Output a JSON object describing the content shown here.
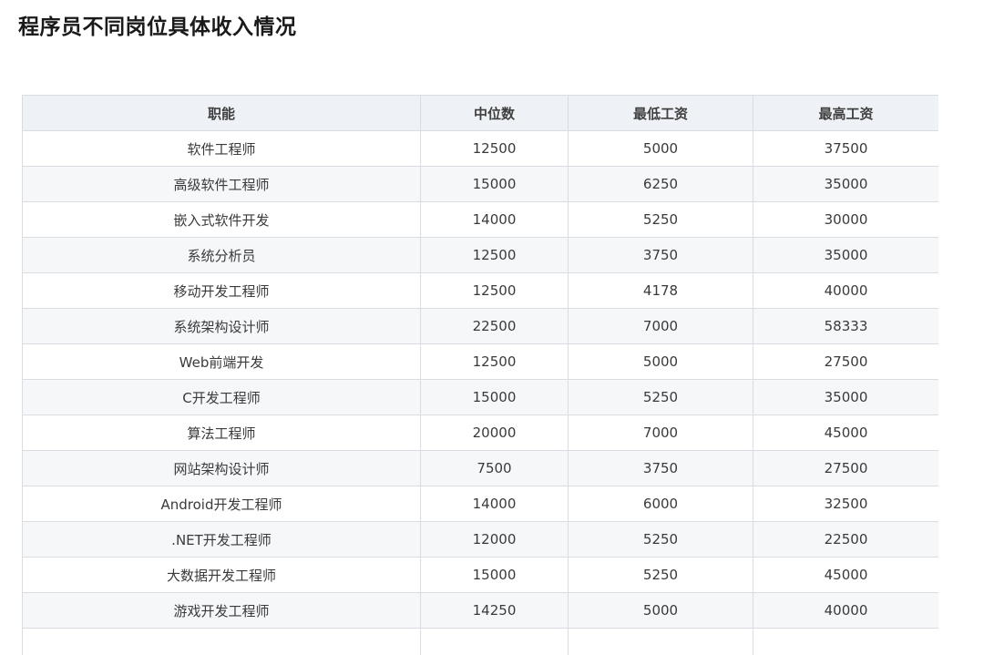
{
  "title": "程序员不同岗位具体收入情况",
  "table": {
    "headers": [
      "职能",
      "中位数",
      "最低工资",
      "最高工资"
    ],
    "rows": [
      [
        "软件工程师",
        "12500",
        "5000",
        "37500"
      ],
      [
        "高级软件工程师",
        "15000",
        "6250",
        "35000"
      ],
      [
        "嵌入式软件开发",
        "14000",
        "5250",
        "30000"
      ],
      [
        "系统分析员",
        "12500",
        "3750",
        "35000"
      ],
      [
        "移动开发工程师",
        "12500",
        "4178",
        "40000"
      ],
      [
        "系统架构设计师",
        "22500",
        "7000",
        "58333"
      ],
      [
        "Web前端开发",
        "12500",
        "5000",
        "27500"
      ],
      [
        "C开发工程师",
        "15000",
        "5250",
        "35000"
      ],
      [
        "算法工程师",
        "20000",
        "7000",
        "45000"
      ],
      [
        "网站架构设计师",
        "7500",
        "3750",
        "27500"
      ],
      [
        "Android开发工程师",
        "14000",
        "6000",
        "32500"
      ],
      [
        ".NET开发工程师",
        "12000",
        "5250",
        "22500"
      ],
      [
        "大数据开发工程师",
        "15000",
        "5250",
        "45000"
      ],
      [
        "游戏开发工程师",
        "14250",
        "5000",
        "40000"
      ],
      [
        "",
        "",
        "",
        ""
      ]
    ]
  }
}
